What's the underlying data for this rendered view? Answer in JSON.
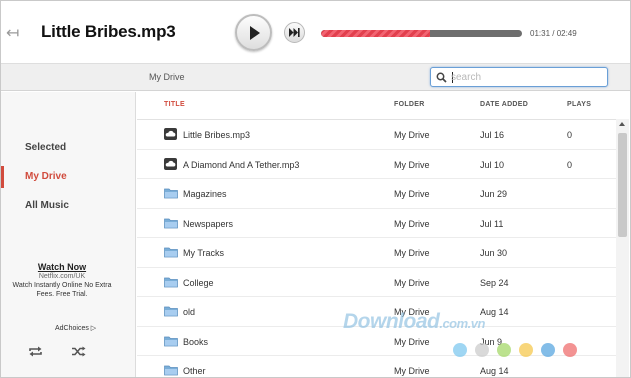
{
  "header": {
    "back_label": "↤",
    "track_title": "Little Bribes.mp3",
    "progress": 0.54,
    "time": "01:31 / 02:49",
    "colors": {
      "progress_fill": "#e2404e",
      "progress_track": "#6e6e6e"
    }
  },
  "subbar": {
    "breadcrumb": "My Drive",
    "search": {
      "placeholder": "search",
      "value": ""
    }
  },
  "sidebar": {
    "items": [
      {
        "label": "Selected",
        "active": false
      },
      {
        "label": "My Drive",
        "active": true
      },
      {
        "label": "All Music",
        "active": false
      }
    ],
    "ad": {
      "title": "Watch Now",
      "url": "Netflix.com/UK",
      "body": "Watch Instantly Online No Extra Fees. Free Trial."
    },
    "adchoices": "AdChoices ▷",
    "icons": [
      "repeat-icon",
      "shuffle-icon"
    ],
    "accent": "#d14b3d"
  },
  "table": {
    "columns": [
      "TITLE",
      "FOLDER",
      "DATE ADDED",
      "PLAYS"
    ],
    "rows": [
      {
        "icon": "cloud-music-icon",
        "title": "Little Bribes.mp3",
        "folder": "My Drive",
        "date": "Jul 16",
        "plays": "0"
      },
      {
        "icon": "cloud-music-icon",
        "title": "A Diamond And A Tether.mp3",
        "folder": "My Drive",
        "date": "Jul 10",
        "plays": "0"
      },
      {
        "icon": "folder-icon",
        "title": "Magazines",
        "folder": "My Drive",
        "date": "Jun 29",
        "plays": ""
      },
      {
        "icon": "folder-icon",
        "title": "Newspapers",
        "folder": "My Drive",
        "date": "Jul 11",
        "plays": ""
      },
      {
        "icon": "folder-icon",
        "title": "My Tracks",
        "folder": "My Drive",
        "date": "Jun 30",
        "plays": ""
      },
      {
        "icon": "folder-icon",
        "title": "College",
        "folder": "My Drive",
        "date": "Sep 24",
        "plays": ""
      },
      {
        "icon": "folder-icon",
        "title": "old",
        "folder": "My Drive",
        "date": "Aug 14",
        "plays": ""
      },
      {
        "icon": "folder-icon",
        "title": "Books",
        "folder": "My Drive",
        "date": "Jun 9",
        "plays": ""
      },
      {
        "icon": "folder-icon",
        "title": "Other",
        "folder": "My Drive",
        "date": "Aug 14",
        "plays": ""
      }
    ]
  },
  "watermark": {
    "text": "Download",
    "suffix": ".com.vn",
    "dot_colors": [
      "#7fc8ef",
      "#cccccc",
      "#a6d86a",
      "#f5c84f",
      "#5aa7e0",
      "#ef6f6f"
    ]
  }
}
